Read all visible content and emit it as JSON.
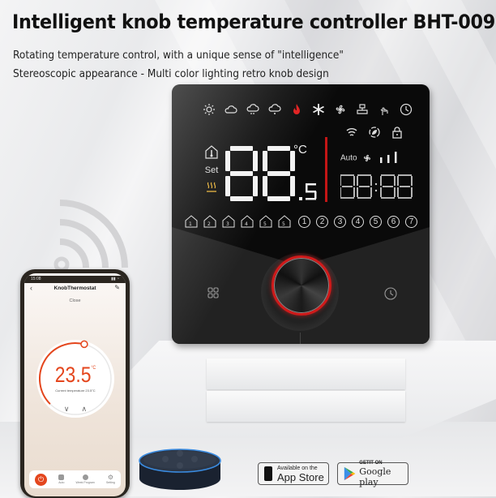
{
  "header": {
    "title": "Intelligent knob temperature controller BHT-009",
    "subtitle_1": "Rotating temperature control, with a unique sense of \"intelligence\"",
    "subtitle_2": "Stereoscopic appearance - Multi color lighting retro knob design"
  },
  "thermostat": {
    "top_icons": [
      "sun-icon",
      "cloud-icon",
      "rain-cloud-icon",
      "drizzle-cloud-icon",
      "flame-icon",
      "snowflake-icon",
      "fan-icon",
      "valve-icon",
      "hand-touch-icon",
      "clock-icon"
    ],
    "status_icons": [
      "wifi-icon",
      "eco-icon",
      "lock-icon"
    ],
    "set_label": "Set",
    "main_digits": "88",
    "decimal_digit": ".5",
    "unit": "°C",
    "fan_label": "Auto",
    "clock_digits": "88:88",
    "program_modes": [
      "1",
      "2",
      "3",
      "4",
      "5",
      "5"
    ],
    "day_numbers": [
      "①",
      "②",
      "③",
      "④",
      "⑤",
      "⑥",
      "⑦"
    ],
    "accent_color": "#d01a1a"
  },
  "phone": {
    "status_time": "15:08",
    "app_title": "KnobThermostat",
    "back_glyph": "‹",
    "edit_glyph": "✎",
    "state": "Close",
    "set_temperature": "23.5",
    "temp_unit": "°C",
    "current_temperature_text": "Current temperature 23.5°C",
    "down_glyph": "∨",
    "up_glyph": "∧",
    "tabs": [
      {
        "label": "",
        "icon": "power-icon"
      },
      {
        "label": "Auto",
        "icon": "auto-icon"
      },
      {
        "label": "Week Program",
        "icon": "week-program-icon"
      },
      {
        "label": "Setting",
        "icon": "gear-icon"
      }
    ],
    "accent_color": "#e4461d"
  },
  "badges": {
    "app_store_small": "Available on the",
    "app_store_big": "App Store",
    "google_small": "GETIT ON",
    "google_big": "Google play"
  }
}
